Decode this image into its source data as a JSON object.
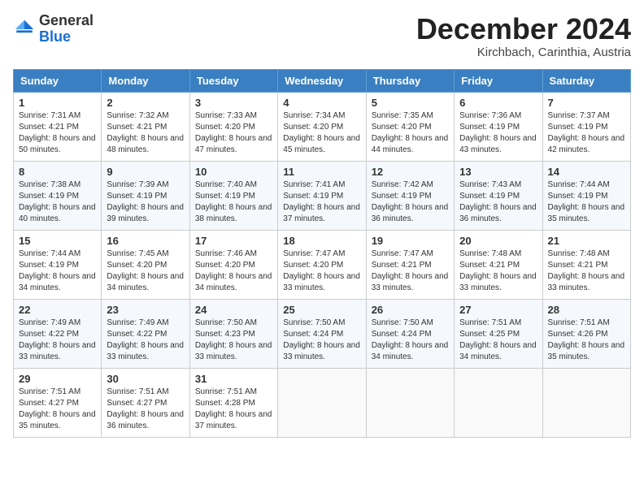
{
  "header": {
    "logo_general": "General",
    "logo_blue": "Blue",
    "month_title": "December 2024",
    "location": "Kirchbach, Carinthia, Austria"
  },
  "weekdays": [
    "Sunday",
    "Monday",
    "Tuesday",
    "Wednesday",
    "Thursday",
    "Friday",
    "Saturday"
  ],
  "weeks": [
    [
      {
        "day": "1",
        "sunrise": "Sunrise: 7:31 AM",
        "sunset": "Sunset: 4:21 PM",
        "daylight": "Daylight: 8 hours and 50 minutes."
      },
      {
        "day": "2",
        "sunrise": "Sunrise: 7:32 AM",
        "sunset": "Sunset: 4:21 PM",
        "daylight": "Daylight: 8 hours and 48 minutes."
      },
      {
        "day": "3",
        "sunrise": "Sunrise: 7:33 AM",
        "sunset": "Sunset: 4:20 PM",
        "daylight": "Daylight: 8 hours and 47 minutes."
      },
      {
        "day": "4",
        "sunrise": "Sunrise: 7:34 AM",
        "sunset": "Sunset: 4:20 PM",
        "daylight": "Daylight: 8 hours and 45 minutes."
      },
      {
        "day": "5",
        "sunrise": "Sunrise: 7:35 AM",
        "sunset": "Sunset: 4:20 PM",
        "daylight": "Daylight: 8 hours and 44 minutes."
      },
      {
        "day": "6",
        "sunrise": "Sunrise: 7:36 AM",
        "sunset": "Sunset: 4:19 PM",
        "daylight": "Daylight: 8 hours and 43 minutes."
      },
      {
        "day": "7",
        "sunrise": "Sunrise: 7:37 AM",
        "sunset": "Sunset: 4:19 PM",
        "daylight": "Daylight: 8 hours and 42 minutes."
      }
    ],
    [
      {
        "day": "8",
        "sunrise": "Sunrise: 7:38 AM",
        "sunset": "Sunset: 4:19 PM",
        "daylight": "Daylight: 8 hours and 40 minutes."
      },
      {
        "day": "9",
        "sunrise": "Sunrise: 7:39 AM",
        "sunset": "Sunset: 4:19 PM",
        "daylight": "Daylight: 8 hours and 39 minutes."
      },
      {
        "day": "10",
        "sunrise": "Sunrise: 7:40 AM",
        "sunset": "Sunset: 4:19 PM",
        "daylight": "Daylight: 8 hours and 38 minutes."
      },
      {
        "day": "11",
        "sunrise": "Sunrise: 7:41 AM",
        "sunset": "Sunset: 4:19 PM",
        "daylight": "Daylight: 8 hours and 37 minutes."
      },
      {
        "day": "12",
        "sunrise": "Sunrise: 7:42 AM",
        "sunset": "Sunset: 4:19 PM",
        "daylight": "Daylight: 8 hours and 36 minutes."
      },
      {
        "day": "13",
        "sunrise": "Sunrise: 7:43 AM",
        "sunset": "Sunset: 4:19 PM",
        "daylight": "Daylight: 8 hours and 36 minutes."
      },
      {
        "day": "14",
        "sunrise": "Sunrise: 7:44 AM",
        "sunset": "Sunset: 4:19 PM",
        "daylight": "Daylight: 8 hours and 35 minutes."
      }
    ],
    [
      {
        "day": "15",
        "sunrise": "Sunrise: 7:44 AM",
        "sunset": "Sunset: 4:19 PM",
        "daylight": "Daylight: 8 hours and 34 minutes."
      },
      {
        "day": "16",
        "sunrise": "Sunrise: 7:45 AM",
        "sunset": "Sunset: 4:20 PM",
        "daylight": "Daylight: 8 hours and 34 minutes."
      },
      {
        "day": "17",
        "sunrise": "Sunrise: 7:46 AM",
        "sunset": "Sunset: 4:20 PM",
        "daylight": "Daylight: 8 hours and 34 minutes."
      },
      {
        "day": "18",
        "sunrise": "Sunrise: 7:47 AM",
        "sunset": "Sunset: 4:20 PM",
        "daylight": "Daylight: 8 hours and 33 minutes."
      },
      {
        "day": "19",
        "sunrise": "Sunrise: 7:47 AM",
        "sunset": "Sunset: 4:21 PM",
        "daylight": "Daylight: 8 hours and 33 minutes."
      },
      {
        "day": "20",
        "sunrise": "Sunrise: 7:48 AM",
        "sunset": "Sunset: 4:21 PM",
        "daylight": "Daylight: 8 hours and 33 minutes."
      },
      {
        "day": "21",
        "sunrise": "Sunrise: 7:48 AM",
        "sunset": "Sunset: 4:21 PM",
        "daylight": "Daylight: 8 hours and 33 minutes."
      }
    ],
    [
      {
        "day": "22",
        "sunrise": "Sunrise: 7:49 AM",
        "sunset": "Sunset: 4:22 PM",
        "daylight": "Daylight: 8 hours and 33 minutes."
      },
      {
        "day": "23",
        "sunrise": "Sunrise: 7:49 AM",
        "sunset": "Sunset: 4:22 PM",
        "daylight": "Daylight: 8 hours and 33 minutes."
      },
      {
        "day": "24",
        "sunrise": "Sunrise: 7:50 AM",
        "sunset": "Sunset: 4:23 PM",
        "daylight": "Daylight: 8 hours and 33 minutes."
      },
      {
        "day": "25",
        "sunrise": "Sunrise: 7:50 AM",
        "sunset": "Sunset: 4:24 PM",
        "daylight": "Daylight: 8 hours and 33 minutes."
      },
      {
        "day": "26",
        "sunrise": "Sunrise: 7:50 AM",
        "sunset": "Sunset: 4:24 PM",
        "daylight": "Daylight: 8 hours and 34 minutes."
      },
      {
        "day": "27",
        "sunrise": "Sunrise: 7:51 AM",
        "sunset": "Sunset: 4:25 PM",
        "daylight": "Daylight: 8 hours and 34 minutes."
      },
      {
        "day": "28",
        "sunrise": "Sunrise: 7:51 AM",
        "sunset": "Sunset: 4:26 PM",
        "daylight": "Daylight: 8 hours and 35 minutes."
      }
    ],
    [
      {
        "day": "29",
        "sunrise": "Sunrise: 7:51 AM",
        "sunset": "Sunset: 4:27 PM",
        "daylight": "Daylight: 8 hours and 35 minutes."
      },
      {
        "day": "30",
        "sunrise": "Sunrise: 7:51 AM",
        "sunset": "Sunset: 4:27 PM",
        "daylight": "Daylight: 8 hours and 36 minutes."
      },
      {
        "day": "31",
        "sunrise": "Sunrise: 7:51 AM",
        "sunset": "Sunset: 4:28 PM",
        "daylight": "Daylight: 8 hours and 37 minutes."
      },
      null,
      null,
      null,
      null
    ]
  ]
}
